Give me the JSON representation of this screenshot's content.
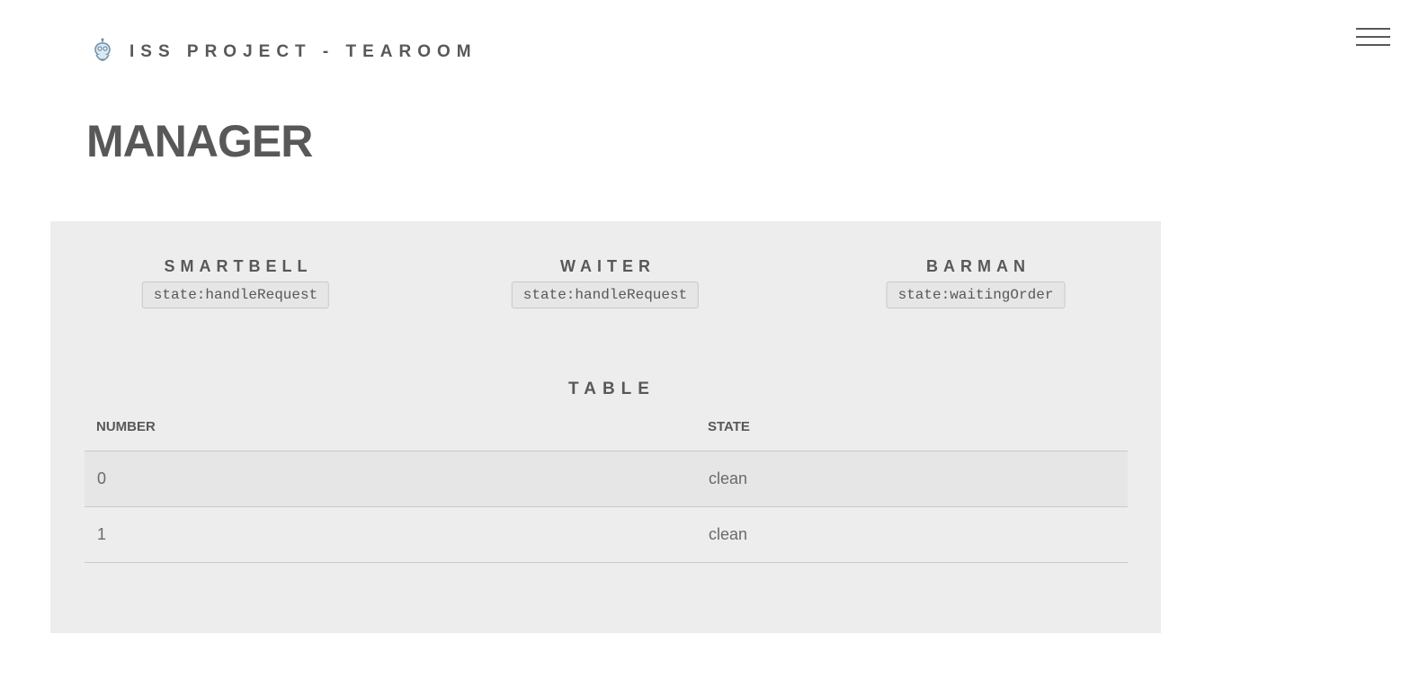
{
  "header": {
    "logo_icon": "robot-icon",
    "brand": "ISS PROJECT - TEAROOM",
    "menu_icon": "hamburger-menu-icon"
  },
  "page": {
    "title": "MANAGER"
  },
  "agents": [
    {
      "name": "SMARTBELL",
      "state": "state:handleRequest"
    },
    {
      "name": "WAITER",
      "state": "state:handleRequest"
    },
    {
      "name": "BARMAN",
      "state": "state:waitingOrder"
    }
  ],
  "table_section": {
    "title": "TABLE",
    "columns": [
      "NUMBER",
      "STATE"
    ],
    "rows": [
      {
        "number": "0",
        "state": "clean"
      },
      {
        "number": "1",
        "state": "clean"
      }
    ]
  },
  "colors": {
    "text": "#585858",
    "panel_background": "#ededed",
    "row_stripe": "#e6e6e6",
    "border": "#c9c9c9"
  }
}
